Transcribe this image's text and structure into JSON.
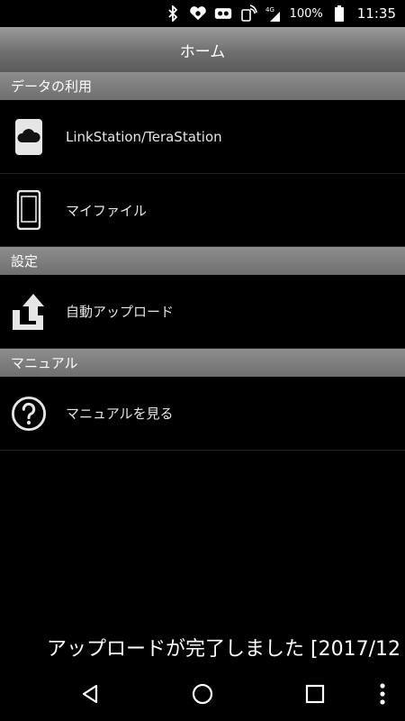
{
  "status_bar": {
    "battery_text": "100%",
    "time": "11:35",
    "icons": [
      "bluetooth-icon",
      "heart-icon",
      "vr-icon",
      "nfc-icon",
      "signal-4g-icon",
      "battery-icon"
    ]
  },
  "header": {
    "title": "ホーム"
  },
  "sections": {
    "data_usage": {
      "header": "データの利用",
      "items": [
        {
          "label": "LinkStation/TeraStation",
          "icon": "cloud-storage-icon"
        },
        {
          "label": "マイファイル",
          "icon": "phone-icon"
        }
      ]
    },
    "settings": {
      "header": "設定",
      "items": [
        {
          "label": "自動アップロード",
          "icon": "upload-icon"
        }
      ]
    },
    "manual": {
      "header": "マニュアル",
      "items": [
        {
          "label": "マニュアルを見る",
          "icon": "help-icon"
        }
      ]
    }
  },
  "toast": {
    "text": "アップロードが完了しました [2017/12"
  },
  "nav_bar": {
    "icons": [
      "back-icon",
      "home-icon",
      "recents-icon",
      "more-icon"
    ]
  }
}
